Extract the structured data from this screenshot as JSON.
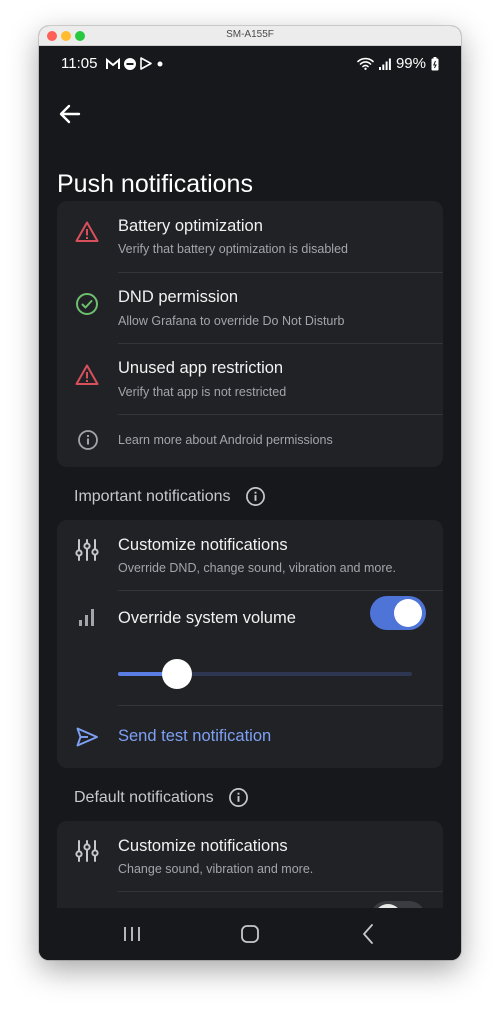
{
  "window": {
    "title": "SM-A155F"
  },
  "status_bar": {
    "time": "11:05",
    "battery": "99%",
    "left_icons": [
      "gmail-icon",
      "dnd-icon",
      "play-store-icon",
      "dot-icon"
    ],
    "right_icons": [
      "wifi-icon",
      "signal-icon",
      "battery-icon"
    ]
  },
  "page": {
    "title": "Push notifications"
  },
  "permissions": {
    "items": [
      {
        "title": "Battery optimization",
        "subtitle": "Verify that battery optimization is disabled",
        "icon": "warning-icon",
        "status_color": "#d94f5c"
      },
      {
        "title": "DND permission",
        "subtitle": "Allow Grafana to override Do Not Disturb",
        "icon": "check-circle-icon",
        "status_color": "#6cc06e"
      },
      {
        "title": "Unused app restriction",
        "subtitle": "Verify that app is not restricted",
        "icon": "warning-icon",
        "status_color": "#d94f5c"
      }
    ],
    "learn_more": "Learn more about Android permissions"
  },
  "important": {
    "header": "Important notifications",
    "customize_title": "Customize notifications",
    "customize_subtitle": "Override DND, change sound, vibration and more.",
    "override_volume_label": "Override system volume",
    "override_volume_on": true,
    "volume_level": 0.2,
    "send_test_label": "Send test notification"
  },
  "default": {
    "header": "Default notifications",
    "customize_title": "Customize notifications",
    "customize_subtitle": "Change sound, vibration and more."
  },
  "colors": {
    "accent": "#4f74d8",
    "link": "#7ea0f4",
    "background": "#17181b",
    "card": "#202226"
  }
}
